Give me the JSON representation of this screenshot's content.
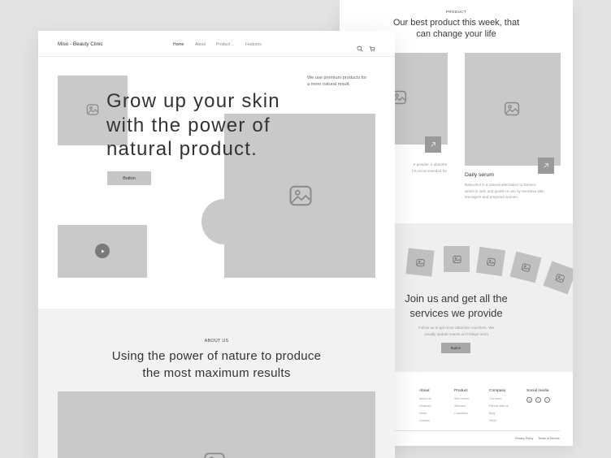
{
  "back_page": {
    "product_section": {
      "eyebrow": "PRODUCT",
      "title_line1": "Our best product this week, that",
      "title_line2": "can change your life",
      "cards": [
        {
          "name": "",
          "desc_line1": "e powder, it absorbs",
          "desc_line2": "t is recommended for"
        },
        {
          "name": "Daily serum",
          "desc_line1": "Bakuchiol is a natural alternative to Retinol,",
          "desc_line2": "which is safe and gentle to use by sensitive skin,",
          "desc_line3": "teenagers and pregnant women."
        }
      ]
    },
    "join_section": {
      "title_line1": "Join us and get all the",
      "title_line2": "services we provide",
      "desc_line1": "Follow us to get more attractive vouchers. We",
      "desc_line2": "usually update events on Fridays morn",
      "button_label": "Button"
    },
    "footer": {
      "columns": [
        {
          "title": "About",
          "links": [
            "About Us",
            "Features",
            "News",
            "Careers"
          ]
        },
        {
          "title": "Product",
          "links": [
            "Skin serum",
            "Skincare",
            "Cosmetics"
          ]
        },
        {
          "title": "Company",
          "links": [
            "Our team",
            "Partner with us",
            "Blog",
            "FAQs"
          ]
        }
      ],
      "social_title": "Social media",
      "social_icons": [
        "instagram-icon",
        "twitter-icon",
        "facebook-icon"
      ],
      "privacy": "Privacy Policy",
      "terms": "Terms of Service"
    }
  },
  "front_page": {
    "brand": "Miso - Beauty Clinic",
    "nav": {
      "home": "Home",
      "about": "About",
      "product": "Product",
      "features": "Features"
    },
    "hero": {
      "title_line1": "Grow up your skin",
      "title_line2": "with the power of",
      "title_line3": "natural product.",
      "note_line1": "We use premium products for",
      "note_line2": "a more natural result.",
      "button_label": "Button"
    },
    "about": {
      "eyebrow": "ABOUT US",
      "title_line1": "Using the power of nature to produce",
      "title_line2": "the most maximum results"
    }
  },
  "colors": {
    "background": "#e4e4e4",
    "placeholder": "#c9c9c9",
    "section_gray": "#efefef",
    "text_dark": "#333333",
    "text_muted": "#999999"
  }
}
